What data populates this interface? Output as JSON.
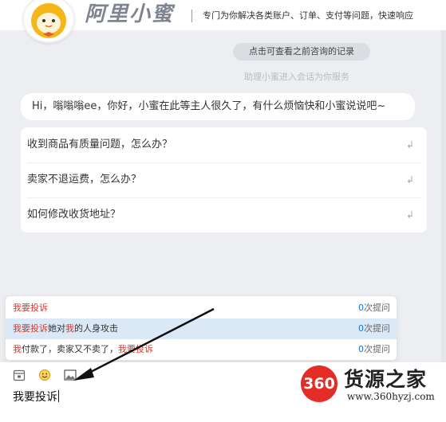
{
  "header": {
    "brand": "阿里小蜜",
    "slogan": "专门为你解决各类账户、订单、支付等问题，快速响应"
  },
  "chat": {
    "history_button": "点击可查看之前咨询的记录",
    "system_note": "助理小蜜进入会话为你服务",
    "greeting": "Hi，嗡嗡嗡ee，你好，小蜜在此等主人很久了，有什么烦恼快和小蜜说说吧~"
  },
  "faq": {
    "items": [
      {
        "label": "收到商品有质量问题，怎么办？"
      },
      {
        "label": "卖家不退运费，怎么办？"
      },
      {
        "label": "如何修改收货地址？"
      }
    ],
    "arrow_glyph": "↲"
  },
  "suggestions": [
    {
      "highlight": "我要投诉",
      "rest": "",
      "count": "0",
      "count_suffix": "次提问"
    },
    {
      "highlight": "我要投诉",
      "rest_mid": "她对",
      "highlight2": "我",
      "rest_end": "的人身攻击",
      "count": "0",
      "count_suffix": "次提问"
    },
    {
      "highlight": "我",
      "rest_mid": "付款了，卖家又不卖了，",
      "highlight2": "我要投诉",
      "rest_end": "",
      "count": "0",
      "count_suffix": "次提问"
    }
  ],
  "composer": {
    "input_value": "我要投诉"
  },
  "toolbar": {
    "icons": [
      "calendar-icon",
      "emoji-icon",
      "image-icon"
    ]
  },
  "watermark": {
    "badge": "360",
    "title": "货源之家",
    "url": "www.360hyzj.com"
  },
  "colors": {
    "highlight": "#d53a2c",
    "count": "#1a73c9",
    "active_row": "#dbe8f6"
  }
}
